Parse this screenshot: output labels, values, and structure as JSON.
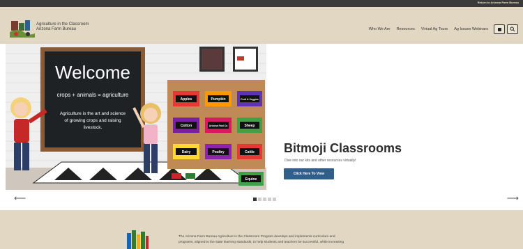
{
  "topbar": {
    "link": "Return to Arizona Farm Bureau"
  },
  "header": {
    "logo_line1": "Agriculture in the Classroom",
    "logo_line2": "Arizona Farm Bureau",
    "nav": [
      "Who We Are",
      "Resources",
      "Virtual Ag Tours",
      "Ag Issues Webinars"
    ],
    "grid_icon": "grid-icon",
    "search_icon": "search-icon"
  },
  "scene": {
    "welcome": "Welcome",
    "equation": "crops + animals = agriculture",
    "definition_1": "Agriculture is the art and science",
    "definition_2": "of growing crops and raising",
    "definition_3": "livestock.",
    "bins": [
      "Apples",
      "Pumpkin",
      "Fruit & Veggies",
      "Cotton",
      "Arizona Fast Ca",
      "Sheep",
      "Dairy",
      "Poultry",
      "Cattle",
      "Equine"
    ]
  },
  "slide": {
    "title": "Bitmoji Classrooms",
    "description": "Dive into our kits and other resources virtually!",
    "button": "Click Here To View"
  },
  "carousel": {
    "prev_icon": "arrow-left-icon",
    "next_icon": "arrow-right-icon",
    "prev_glyph": "⟵",
    "next_glyph": "⟶",
    "slides_total": 5,
    "active_slide": 1
  },
  "about": {
    "line1": "The Arizona Farm Bureau Agriculture in the Classroom Program develops and implements curriculum and",
    "line2": "programs, aligned to the state learning standards, to help students and teachers be successful, while increasing"
  },
  "colors": {
    "header_bg": "#e2d7c2",
    "topbar_bg": "#3a3a3a",
    "button": "#2f5f8a",
    "chalkboard": "#1e2224"
  }
}
